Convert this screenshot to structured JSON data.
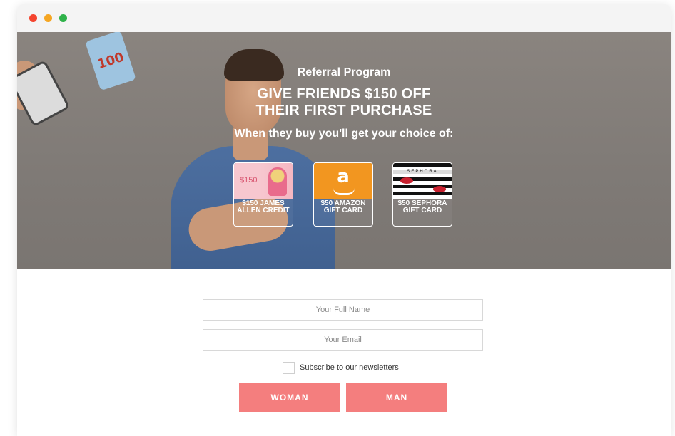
{
  "window": {
    "controls": [
      "close",
      "minimize",
      "maximize"
    ],
    "colors": {
      "close": "#f4442e",
      "minimize": "#f5a623",
      "maximize": "#2fb24a"
    }
  },
  "hero": {
    "title": "Referral Program",
    "headline_line1": "GIVE FRIENDS $150 OFF",
    "headline_line2": "THEIR FIRST PURCHASE",
    "subheadline": "When they buy you'll get your choice of:",
    "sticker_text": "100",
    "cards": [
      {
        "image_text": "$150",
        "label": "$150 JAMES ALLEN CREDIT"
      },
      {
        "image_text": "a",
        "label": "$50 AMAZON GIFT CARD"
      },
      {
        "image_text": "SEPHORA",
        "label": "$50 SEPHORA GIFT CARD"
      }
    ]
  },
  "form": {
    "name_placeholder": "Your Full Name",
    "email_placeholder": "Your Email",
    "newsletter_label": "Subscribe to our newsletters",
    "woman_button": "WOMAN",
    "man_button": "MAN"
  },
  "colors": {
    "button": "#f47e7e",
    "hero_background": "#827c78",
    "amazon": "#f29620"
  }
}
